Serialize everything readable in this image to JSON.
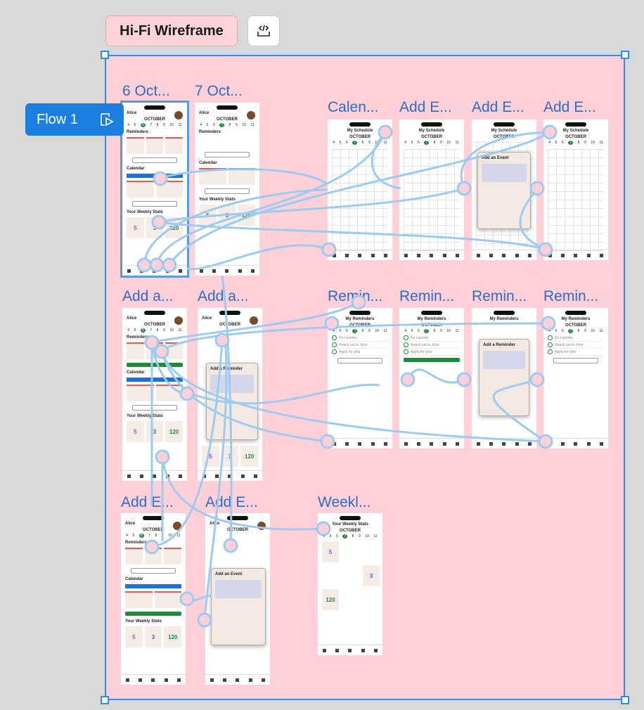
{
  "section": {
    "tag": "Hi-Fi Wireframe",
    "dev_icon": "code-brackets-icon"
  },
  "flow": {
    "label": "Flow 1",
    "icon": "flow-play-icon"
  },
  "frames": [
    "6 Oct...",
    "7 Oct...",
    "Calen...",
    "Add E...",
    "Add E...",
    "Add E...",
    "Add a...",
    "Add a...",
    "Remin...",
    "Remin...",
    "Remin...",
    "Remin...",
    "Add E...",
    "Add E...",
    "Weekl..."
  ],
  "phone": {
    "user": "Alice",
    "month": "OCTOBER",
    "days": [
      "4",
      "5",
      "6",
      "7",
      "8",
      "9",
      "10",
      "11"
    ],
    "reminders": "Reminders",
    "calendar": "Calendar",
    "weekly_stats": "Your Weekly Stats",
    "stats": [
      "5",
      "3",
      "120"
    ],
    "schedule_title": "My Schedule",
    "reminders_title": "My Reminders",
    "add_event": "Add an Event",
    "add_reminder": "Add a Reminder",
    "weekly_title": "Your Weekly Stats",
    "reminder_items": [
      "Do Laundry",
      "Reach out to John",
      "Apply for jobs"
    ]
  },
  "colors": {
    "section_bg": "#ffd0d8",
    "accent": "#2d8cf0",
    "connector": "#9ccbf2",
    "green": "#1f8a3a"
  }
}
